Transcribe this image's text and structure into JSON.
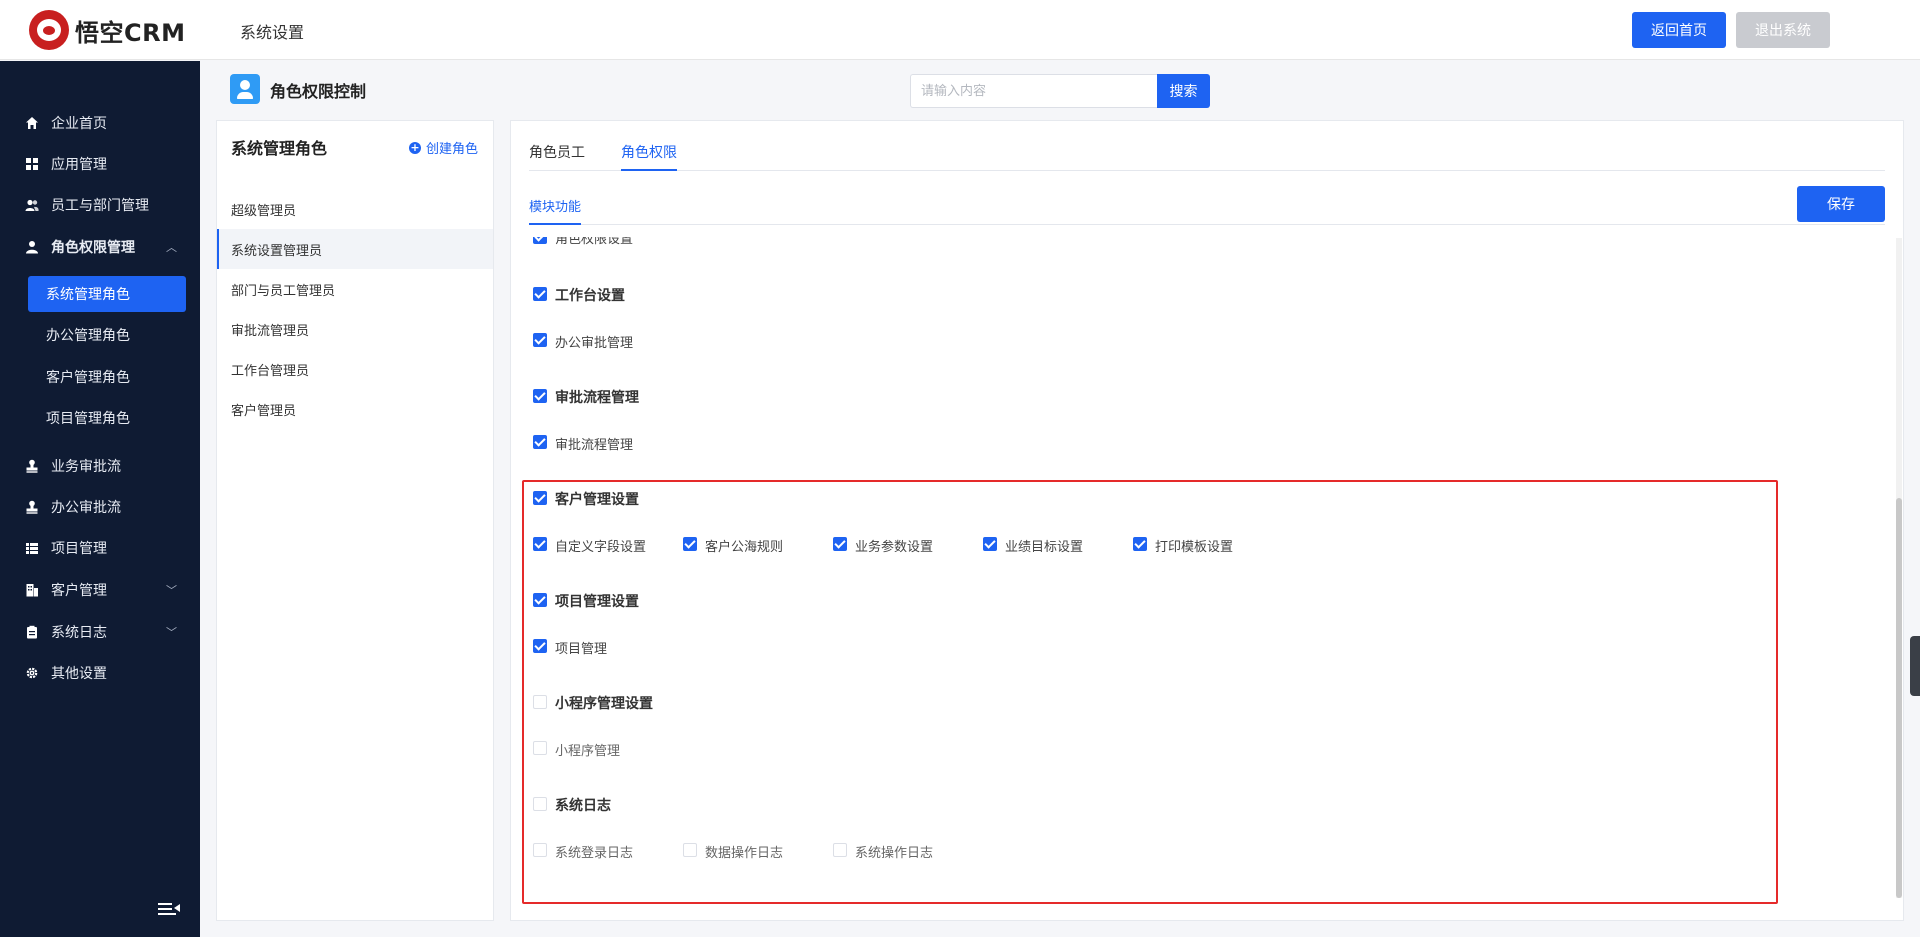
{
  "app": {
    "brand": "悟空CRM",
    "breadcrumb": "系统设置"
  },
  "header": {
    "home_label": "返回首页",
    "exit_label": "退出系统"
  },
  "sidebar": {
    "items": [
      {
        "label": "企业首页",
        "icon": "home-icon"
      },
      {
        "label": "应用管理",
        "icon": "grid-icon"
      },
      {
        "label": "员工与部门管理",
        "icon": "users-icon"
      },
      {
        "label": "角色权限管理",
        "icon": "user-icon",
        "expanded": true
      },
      {
        "label": "业务审批流",
        "icon": "stamp-icon"
      },
      {
        "label": "办公审批流",
        "icon": "stamp-icon"
      },
      {
        "label": "项目管理",
        "icon": "list-icon"
      },
      {
        "label": "客户管理",
        "icon": "building-icon"
      },
      {
        "label": "系统日志",
        "icon": "clipboard-icon"
      },
      {
        "label": "其他设置",
        "icon": "gear-icon"
      }
    ],
    "sub_items": [
      "系统管理角色",
      "办公管理角色",
      "客户管理角色",
      "项目管理角色"
    ],
    "active_sub": "系统管理角色"
  },
  "page": {
    "title": "角色权限控制"
  },
  "search": {
    "placeholder": "请输入内容",
    "button_label": "搜索"
  },
  "roles": {
    "title": "系统管理角色",
    "create_label": "创建角色",
    "items": [
      "超级管理员",
      "系统设置管理员",
      "部门与员工管理员",
      "审批流管理员",
      "工作台管理员",
      "客户管理员"
    ],
    "selected": "系统设置管理员"
  },
  "tabs": [
    "角色员工",
    "角色权限"
  ],
  "active_tab": "角色权限",
  "subtab": "模块功能",
  "save_label": "保存",
  "permissions": {
    "partial_top_label": "角色权限设置",
    "groups": [
      {
        "label": "工作台设置",
        "checked": true,
        "items": [
          {
            "label": "办公审批管理",
            "checked": true
          }
        ]
      },
      {
        "label": "审批流程管理",
        "checked": true,
        "items": [
          {
            "label": "审批流程管理",
            "checked": true
          }
        ]
      },
      {
        "label": "客户管理设置",
        "checked": true,
        "items": [
          {
            "label": "自定义字段设置",
            "checked": true
          },
          {
            "label": "客户公海规则",
            "checked": true
          },
          {
            "label": "业务参数设置",
            "checked": true
          },
          {
            "label": "业绩目标设置",
            "checked": true
          },
          {
            "label": "打印模板设置",
            "checked": true
          }
        ]
      },
      {
        "label": "项目管理设置",
        "checked": true,
        "items": [
          {
            "label": "项目管理",
            "checked": true
          }
        ]
      },
      {
        "label": "小程序管理设置",
        "checked": false,
        "items": [
          {
            "label": "小程序管理",
            "checked": false
          }
        ]
      },
      {
        "label": "系统日志",
        "checked": false,
        "items": [
          {
            "label": "系统登录日志",
            "checked": false
          },
          {
            "label": "数据操作日志",
            "checked": false
          },
          {
            "label": "系统操作日志",
            "checked": false
          }
        ]
      }
    ]
  },
  "colors": {
    "primary": "#1e63f2",
    "sidebar_bg": "#0f1b33",
    "highlight_border": "#e52a2a",
    "disabled_button": "#c9cbd0"
  }
}
